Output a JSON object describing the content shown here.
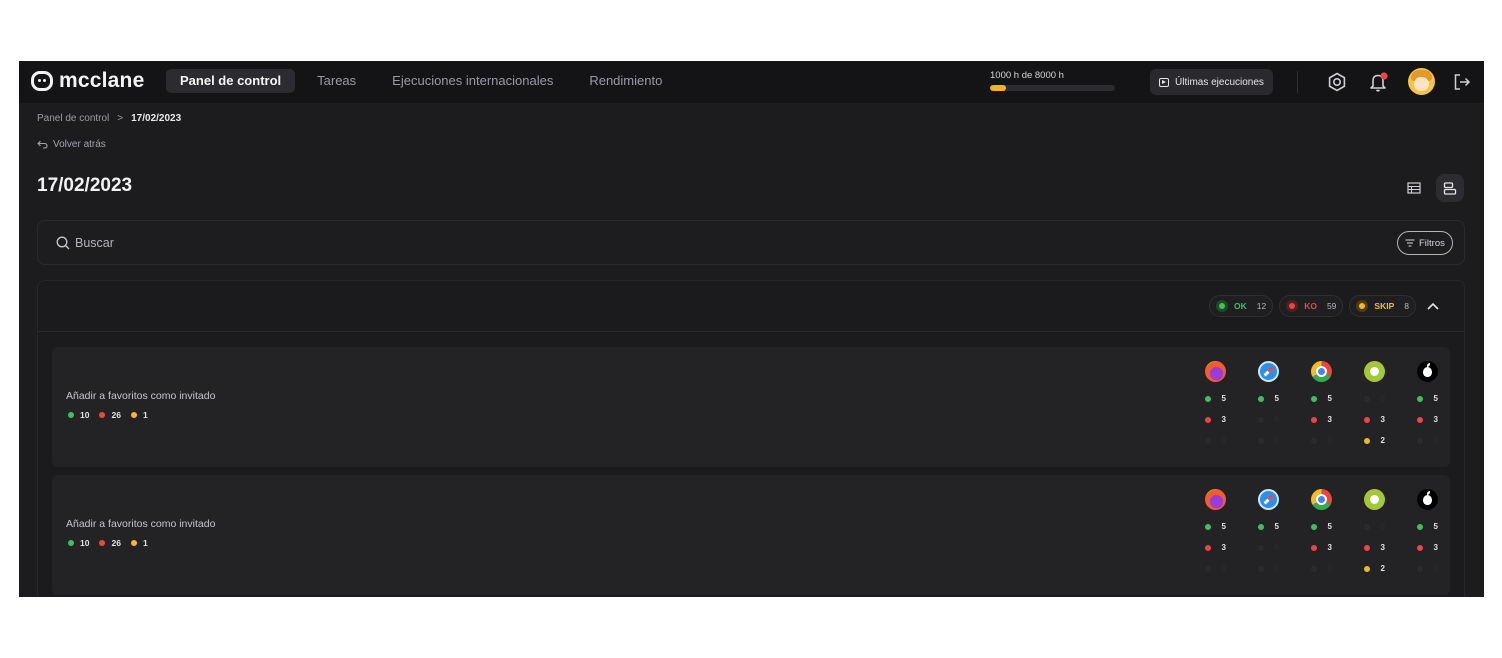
{
  "brand": "mcclane",
  "nav": [
    {
      "label": "Panel de control",
      "active": true
    },
    {
      "label": "Tareas",
      "active": false
    },
    {
      "label": "Ejecuciones internacionales",
      "active": false
    },
    {
      "label": "Rendimiento",
      "active": false
    }
  ],
  "usage": {
    "label": "1000 h de 8000 h",
    "fraction": 0.125,
    "color": "#f4b321"
  },
  "last_runs_label": "Últimas ejecuciones",
  "breadcrumb": {
    "root": "Panel de control",
    "separator": ">",
    "current": "17/02/2023"
  },
  "back_label": "Volver atrás",
  "page_title": "17/02/2023",
  "search": {
    "placeholder": "Buscar",
    "value": ""
  },
  "filters_label": "Filtros",
  "summary": [
    {
      "label": "OK",
      "count": "12",
      "color": "#3ec25b"
    },
    {
      "label": "KO",
      "count": "59",
      "color": "#ef4444"
    },
    {
      "label": "SKIP",
      "count": "8",
      "color": "#f5b827"
    }
  ],
  "colors": {
    "ok": "#3ec25b",
    "ko": "#ef4444",
    "skip": "#f5b827"
  },
  "tasks": [
    {
      "title": "Añadir a favoritos como invitado",
      "stats": {
        "ok": "10",
        "ko": "26",
        "skip": "1"
      },
      "browsers": [
        {
          "icon": "firefox-icon",
          "ok": "5",
          "ko": "3",
          "skip": null
        },
        {
          "icon": "safari-icon",
          "ok": "5",
          "ko": null,
          "skip": null
        },
        {
          "icon": "chrome-icon",
          "ok": "5",
          "ko": "3",
          "skip": null
        },
        {
          "icon": "android-icon",
          "ok": null,
          "ko": "3",
          "skip": "2"
        },
        {
          "icon": "apple-icon",
          "ok": "5",
          "ko": "3",
          "skip": null
        }
      ]
    },
    {
      "title": "Añadir a favoritos como invitado",
      "stats": {
        "ok": "10",
        "ko": "26",
        "skip": "1"
      },
      "browsers": [
        {
          "icon": "firefox-icon",
          "ok": "5",
          "ko": "3",
          "skip": null
        },
        {
          "icon": "safari-icon",
          "ok": "5",
          "ko": null,
          "skip": null
        },
        {
          "icon": "chrome-icon",
          "ok": "5",
          "ko": "3",
          "skip": null
        },
        {
          "icon": "android-icon",
          "ok": null,
          "ko": "3",
          "skip": "2"
        },
        {
          "icon": "apple-icon",
          "ok": "5",
          "ko": "3",
          "skip": null
        }
      ]
    }
  ]
}
